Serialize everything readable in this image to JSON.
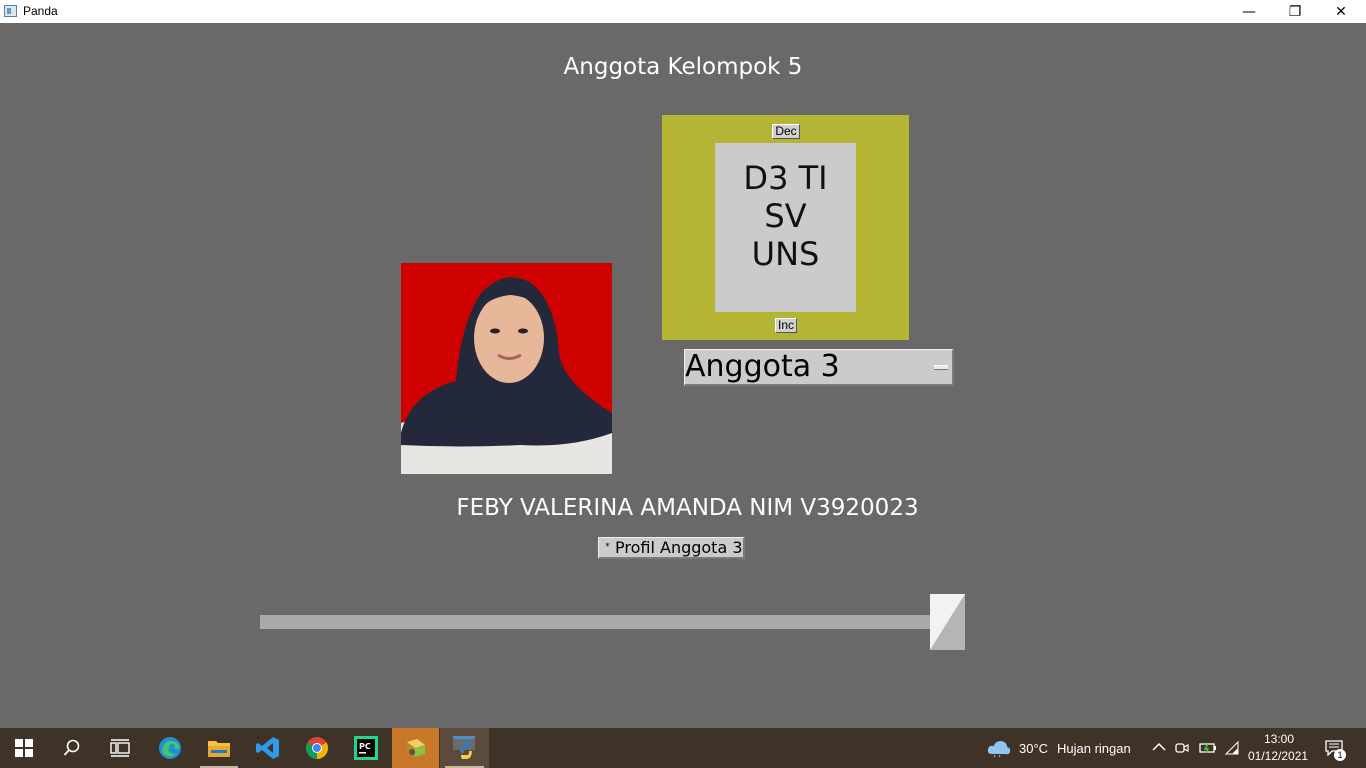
{
  "window": {
    "title": "Panda",
    "controls": {
      "minimize": "—",
      "maximize": "❐",
      "close": "✕"
    }
  },
  "app": {
    "heading": "Anggota Kelompok 5",
    "frame": {
      "dec_label": "Dec",
      "inc_label": "Inc",
      "text_lines": [
        "D3 TI",
        "SV",
        "UNS"
      ]
    },
    "dropdown": {
      "selected": "Anggota 3"
    },
    "member_name": "FEBY VALERINA AMANDA NIM V3920023",
    "checkbox": {
      "mark": "*",
      "label": "Profil Anggota 3"
    },
    "slider": {
      "value_fraction": 1.0
    }
  },
  "taskbar": {
    "weather_temp": "30°C",
    "weather_desc": "Hujan ringan",
    "time": "13:00",
    "date": "01/12/2021",
    "notification_count": "1"
  },
  "colors": {
    "background": "#696969",
    "frame": "#b4b534",
    "photo_bg": "#cf0000",
    "taskbar": "#3f3226"
  }
}
